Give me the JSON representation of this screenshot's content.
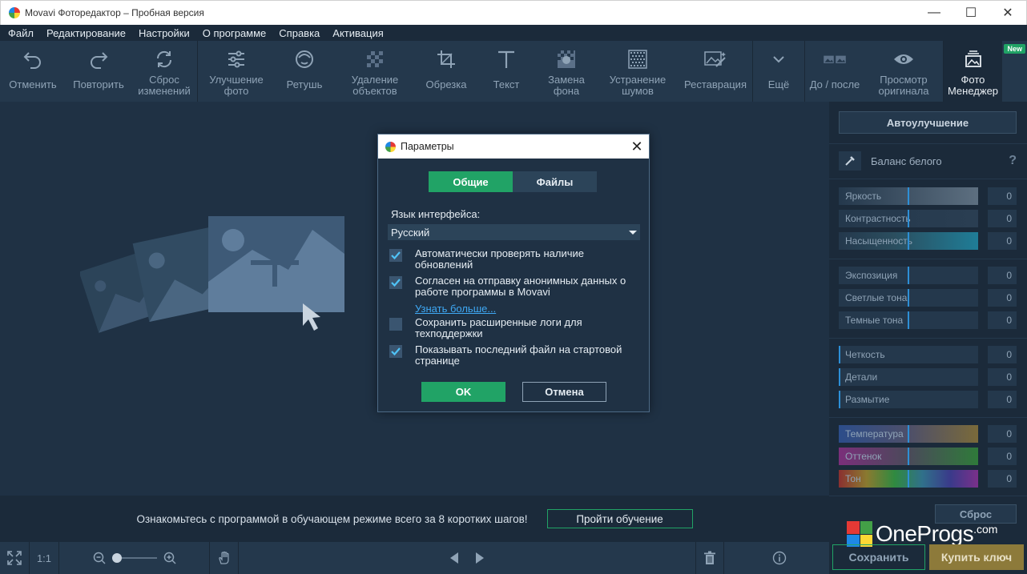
{
  "window": {
    "title": "Movavi Фоторедактор – Пробная версия",
    "minimize": "—",
    "maximize": "☐",
    "close": "✕"
  },
  "menu": [
    "Файл",
    "Редактирование",
    "Настройки",
    "О программе",
    "Справка",
    "Активация"
  ],
  "toolbar": {
    "undo": "Отменить",
    "redo": "Повторить",
    "reset": "Сброс\nизменений",
    "enhance": "Улучшение\nфото",
    "retouch": "Ретушь",
    "remove_objects": "Удаление\nобъектов",
    "crop": "Обрезка",
    "text": "Текст",
    "bg_replace": "Замена\nфона",
    "denoise": "Устранение\nшумов",
    "restore": "Реставрация",
    "more": "Ещё",
    "before_after": "До / после",
    "view_original": "Просмотр\nоригинала",
    "photo_manager": "Фото\nМенеджер",
    "new_badge": "New"
  },
  "tutorial": {
    "text": "Ознакомьтесь с программой в обучающем режиме всего за 8 коротких шагов!",
    "button": "Пройти обучение"
  },
  "bottom": {
    "ratio": "1:1"
  },
  "panel": {
    "auto_enhance": "Автоулучшение",
    "white_balance": "Баланс белого",
    "help": "?",
    "sliders": [
      {
        "label": "Яркость",
        "value": "0"
      },
      {
        "label": "Контрастность",
        "value": "0"
      },
      {
        "label": "Насыщенность",
        "value": "0"
      },
      {
        "label": "Экспозиция",
        "value": "0"
      },
      {
        "label": "Светлые тона",
        "value": "0"
      },
      {
        "label": "Темные тона",
        "value": "0"
      },
      {
        "label": "Четкость",
        "value": "0"
      },
      {
        "label": "Детали",
        "value": "0"
      },
      {
        "label": "Размытие",
        "value": "0"
      },
      {
        "label": "Температура",
        "value": "0"
      },
      {
        "label": "Оттенок",
        "value": "0"
      },
      {
        "label": "Тон",
        "value": "0"
      }
    ],
    "reset": "Сброс",
    "save": "Сохранить",
    "buy": "Купить ключ"
  },
  "watermark": {
    "text": "OneProgs",
    "suffix": ".com"
  },
  "dialog": {
    "title": "Параметры",
    "tabs": [
      "Общие",
      "Файлы"
    ],
    "language_label": "Язык интерфейса:",
    "language_value": "Русский",
    "options": [
      {
        "text": "Автоматически проверять наличие обновлений",
        "checked": true
      },
      {
        "text": "Согласен на отправку анонимных данных о работе программы в Movavi",
        "checked": true
      },
      {
        "text": "Сохранить расширенные логи для техподдержки",
        "checked": false
      },
      {
        "text": "Показывать последний файл на стартовой странице",
        "checked": true
      }
    ],
    "learn_more": "Узнать больше...",
    "ok": "OK",
    "cancel": "Отмена"
  },
  "colors": {
    "accent_green": "#21a366",
    "buy_gold": "#8d7a3a",
    "slider_marker": "#2d8fd6"
  }
}
